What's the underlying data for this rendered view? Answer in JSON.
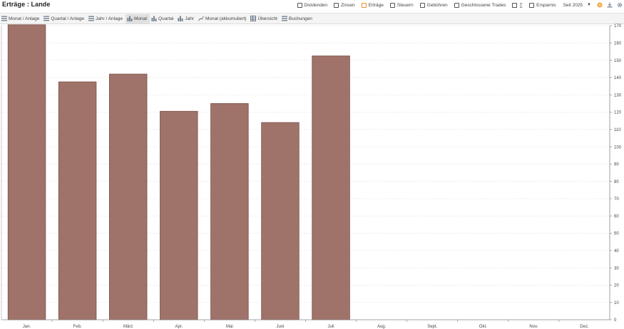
{
  "header": {
    "title": "Erträge : Lande"
  },
  "filters": [
    {
      "label": "Dividenden",
      "checked": false
    },
    {
      "label": "Zinsen",
      "checked": false
    },
    {
      "label": "Erträge",
      "checked": true
    },
    {
      "label": "Steuern",
      "checked": false
    },
    {
      "label": "Gebühren",
      "checked": false
    },
    {
      "label": "Geschlossene Trades",
      "checked": false
    },
    {
      "label": "∑",
      "checked": false
    },
    {
      "label": "Ersparnis",
      "checked": false
    }
  ],
  "period": {
    "value": "Seit 2025"
  },
  "toolbar_icons": [
    "coin-icon",
    "download-icon",
    "gear-icon"
  ],
  "tabs": [
    {
      "label": "Monat / Anlage",
      "icon": "list-icon",
      "active": false
    },
    {
      "label": "Quartal / Anlage",
      "icon": "list-icon",
      "active": false
    },
    {
      "label": "Jahr / Anlage",
      "icon": "list-icon",
      "active": false
    },
    {
      "label": "Monat",
      "icon": "bar-chart-icon",
      "active": true
    },
    {
      "label": "Quartal",
      "icon": "bar-chart-icon",
      "active": false
    },
    {
      "label": "Jahr",
      "icon": "bar-chart-icon",
      "active": false
    },
    {
      "label": "Monat (akkumuliert)",
      "icon": "line-chart-icon",
      "active": false
    },
    {
      "label": "Übersicht",
      "icon": "table-icon",
      "active": false
    },
    {
      "label": "Buchungen",
      "icon": "list-icon",
      "active": false
    }
  ],
  "chart_data": {
    "type": "bar",
    "categories": [
      "Jan.",
      "Feb.",
      "März",
      "Apr.",
      "Mai",
      "Juni",
      "Juli",
      "Aug.",
      "Sept.",
      "Okt.",
      "Nov.",
      "Dez."
    ],
    "values": [
      171,
      137.5,
      142,
      120.5,
      125,
      114,
      152.5,
      null,
      null,
      null,
      null,
      null
    ],
    "ylim": [
      0,
      170
    ],
    "y_ticks": [
      0,
      10,
      20,
      30,
      40,
      50,
      60,
      70,
      80,
      90,
      100,
      110,
      120,
      130,
      140,
      150,
      160,
      170
    ],
    "y_axis_position": "right",
    "grid": true,
    "bar_color": "#a0736a",
    "bar_edge_color": "#7a4e45"
  }
}
